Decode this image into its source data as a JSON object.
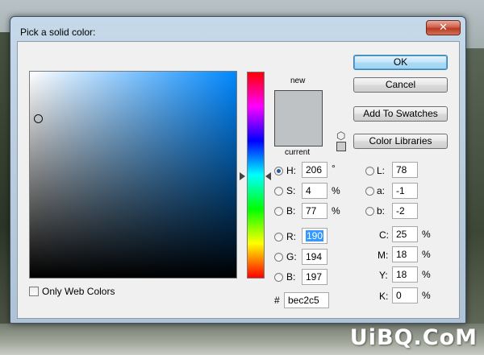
{
  "dialog": {
    "title": "Pick a solid color:",
    "close_glyph": "✕"
  },
  "swatch": {
    "new_label": "new",
    "current_label": "current",
    "new_color": "#bec2c5",
    "current_color": "#bec2c5"
  },
  "buttons": {
    "ok": "OK",
    "cancel": "Cancel",
    "add_to_swatches": "Add To Swatches",
    "color_libraries": "Color Libraries"
  },
  "hsb": {
    "h_label": "H:",
    "h_value": "206",
    "h_unit": "°",
    "s_label": "S:",
    "s_value": "4",
    "s_unit": "%",
    "b_label": "B:",
    "b_value": "77",
    "b_unit": "%"
  },
  "rgb": {
    "r_label": "R:",
    "r_value": "190",
    "g_label": "G:",
    "g_value": "194",
    "b_label": "B:",
    "b_value": "197"
  },
  "lab": {
    "l_label": "L:",
    "l_value": "78",
    "a_label": "a:",
    "a_value": "-1",
    "b_label": "b:",
    "b_value": "-2"
  },
  "cmyk": {
    "c_label": "C:",
    "c_value": "25",
    "m_label": "M:",
    "m_value": "18",
    "y_label": "Y:",
    "y_value": "18",
    "k_label": "K:",
    "k_value": "0",
    "unit": "%"
  },
  "hex": {
    "label": "#",
    "value": "bec2c5"
  },
  "only_web_colors": {
    "label": "Only Web Colors",
    "checked": false
  },
  "watermark": "UiBQ.CoM",
  "colors": {
    "field_hue": "#0088ff",
    "selected_text_bg": "#3399ff"
  }
}
